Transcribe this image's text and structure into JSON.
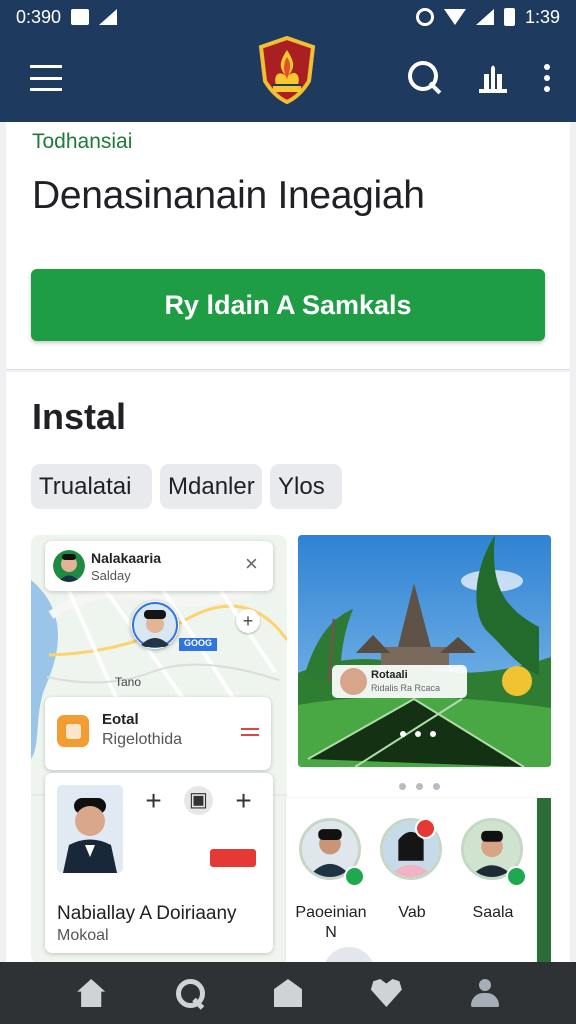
{
  "status_bar": {
    "left_text": "0:390",
    "time": "1:39"
  },
  "header": {
    "logo_label": "government-emblem",
    "icons": [
      "menu-icon",
      "search-icon",
      "bank-icon",
      "more-icon"
    ]
  },
  "hero": {
    "eyebrow": "Todhansiai",
    "title": "Denasinanain Ineagiah",
    "cta_label": "Ry ldain A Samkals"
  },
  "install": {
    "title": "Instal",
    "chips": [
      "Trualatai",
      "Mdanler",
      "Ylos"
    ],
    "map_card": {
      "name": "Nalakaaria",
      "subtitle": "Salday"
    },
    "map_tag": "GOOG",
    "map_label": "Tano",
    "place": {
      "name": "Eotal",
      "subtitle": "Rigelothida"
    },
    "profile": {
      "name": "Nabiallay A Doiriaany",
      "role": "Mokoal"
    },
    "palace_overlay": {
      "name": "Rotaali",
      "subtitle": "Ridalis Ra Rcaca"
    },
    "members": [
      {
        "name": "Paoeinian",
        "extra": "N"
      },
      {
        "name": "Vab"
      },
      {
        "name": "Saala"
      }
    ]
  },
  "bottom_nav": [
    "home-icon",
    "search-icon",
    "store-icon",
    "heart-icon",
    "profile-icon"
  ],
  "colors": {
    "top_bar": "#1e3a5f",
    "accent_green": "#1f9d45",
    "bottom_nav": "#2f3235"
  }
}
